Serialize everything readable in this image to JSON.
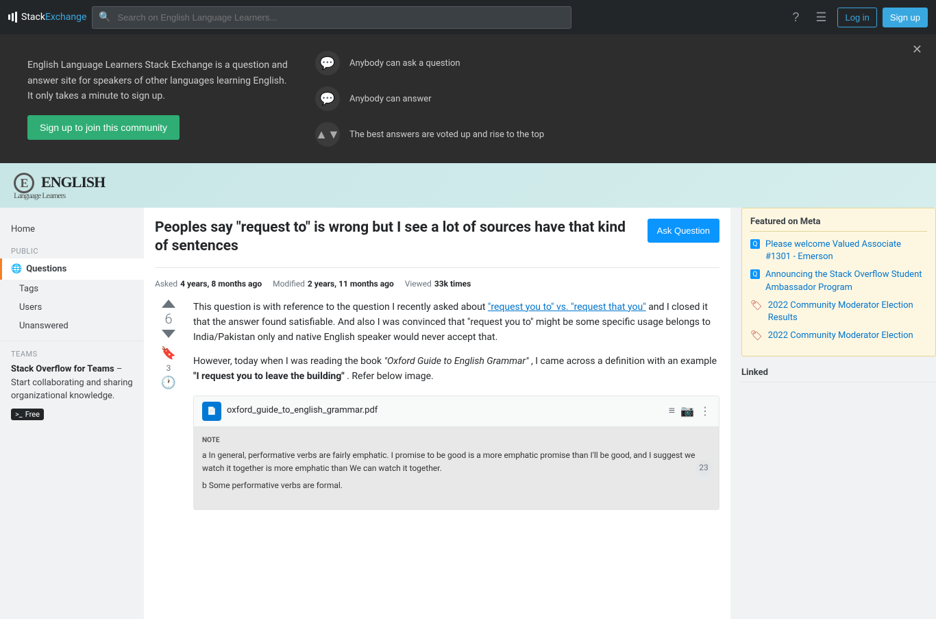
{
  "topnav": {
    "logo_text": "Stack",
    "logo_exchange": "Exchange",
    "search_placeholder": "Search on English Language Learners...",
    "login_label": "Log in",
    "signup_label": "Sign up"
  },
  "hero": {
    "description": "English Language Learners Stack Exchange is a question and answer site for speakers of other languages learning English. It only takes a minute to sign up.",
    "cta_label": "Sign up to join this community",
    "features": [
      {
        "text": "Anybody can ask a question"
      },
      {
        "text": "Anybody can answer"
      },
      {
        "text": "The best answers are voted up and rise to the top"
      }
    ]
  },
  "site": {
    "name": "ENGLISH",
    "subtitle": "Language Learners"
  },
  "sidebar": {
    "home_label": "Home",
    "public_label": "PUBLIC",
    "questions_label": "Questions",
    "tags_label": "Tags",
    "users_label": "Users",
    "unanswered_label": "Unanswered",
    "teams_label": "TEAMS",
    "teams_cta": "Stack Overflow for Teams",
    "teams_desc": " – Start collaborating and sharing organizational knowledge.",
    "free_label": "Free"
  },
  "question": {
    "title": "Peoples say \"request to\" is wrong but I see a lot of sources have that kind of sentences",
    "ask_button": "Ask Question",
    "asked_label": "Asked",
    "asked_ago": "4 years, 8 months ago",
    "modified_label": "Modified",
    "modified_ago": "2 years, 11 months ago",
    "viewed_label": "Viewed",
    "viewed_count": "33k times",
    "vote_count": "6",
    "bookmark_count": "3",
    "body_p1": "This question is with reference to the question I recently asked about ",
    "body_link": "\"request you to\" vs. \"request that you\"",
    "body_p2": " and I closed it that the answer found satisfiable. And also I was convinced that \"request you to\" might be some specific usage belongs to India/Pakistan only and native English speaker would never accept that.",
    "body_p3": "However, today when I was reading the book ",
    "body_book": "\"Oxford Guide to English Grammar\"",
    "body_p4": ", I came across a definition with an example ",
    "body_example": "\"I request you to leave the building\"",
    "body_p5": ". Refer below image.",
    "pdf_filename": "oxford_guide_to_english_grammar.pdf",
    "pdf_page_number": "23",
    "pdf_note_label": "NOTE",
    "pdf_note_text": "a  In general, performative verbs are fairly emphatic. I promise to be good is a more emphatic promise than I'll be good, and I suggest we watch it together is more emphatic than We can watch it together.",
    "pdf_note_text2": "b  Some performative verbs are formal."
  },
  "right_sidebar": {
    "featured_title": "Featured on Meta",
    "items": [
      {
        "type": "blue_q",
        "text": "Please welcome Valued Associate #1301 - Emerson"
      },
      {
        "type": "blue_q",
        "text": "Announcing the Stack Overflow Student Ambassador Program"
      },
      {
        "type": "award",
        "text": "2022 Community Moderator Election Results"
      },
      {
        "type": "award",
        "text": "2022 Community Moderator Election"
      }
    ],
    "linked_label": "Linked"
  }
}
